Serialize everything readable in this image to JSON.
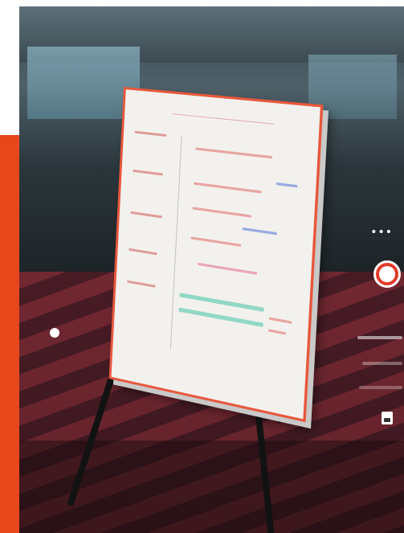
{
  "screen": {
    "accent_color": "#e8471c",
    "shutter_color": "#e23b2a"
  },
  "camera_controls": {
    "more_icon": "more-horizontal-icon",
    "shutter_icon": "shutter-icon",
    "mode_indicator_icon": "dot-icon",
    "save_icon": "save-icon"
  }
}
